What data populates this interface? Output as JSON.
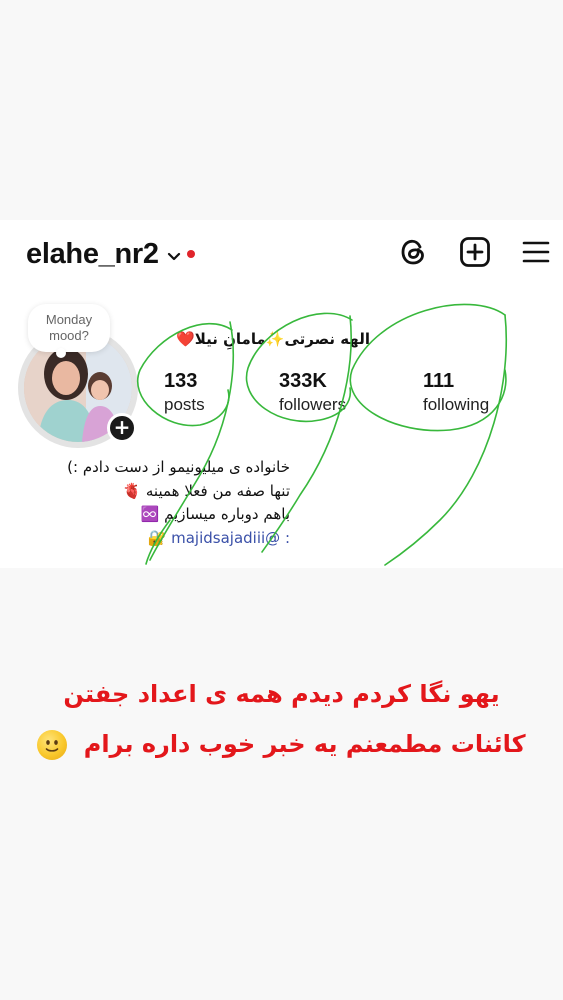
{
  "profile": {
    "username": "elahe_nr2",
    "note": "Monday mood?",
    "display_name": "الهه نصرتی✨مامانِ نیلا❤️",
    "stats": [
      {
        "value": "133",
        "label": "posts"
      },
      {
        "value": "333K",
        "label": "followers"
      },
      {
        "value": "111",
        "label": "following"
      }
    ],
    "bio": [
      "خانواده ی میلیونیمو از دست دادم  :)",
      "تنها صفه من فعلا همینه 🫀",
      "باهم دوباره میسازیم ♾️",
      ": @majidsajadiii 🔐"
    ]
  },
  "icons": {
    "threads": "threads-icon",
    "create": "plus-square-icon",
    "menu": "hamburger-menu-icon",
    "dropdown": "chevron-down-icon",
    "add_story": "plus-icon"
  },
  "caption": {
    "line1": "یهو نگا کردم دیدم همه ی اعداد جفتن",
    "line2": "کائنات مطمعنم یه خبر خوب داره برام"
  },
  "colors": {
    "notification_dot": "#e0242b",
    "caption_text": "#e3171b",
    "scribble": "#38b83c",
    "link": "#3a50a8"
  }
}
